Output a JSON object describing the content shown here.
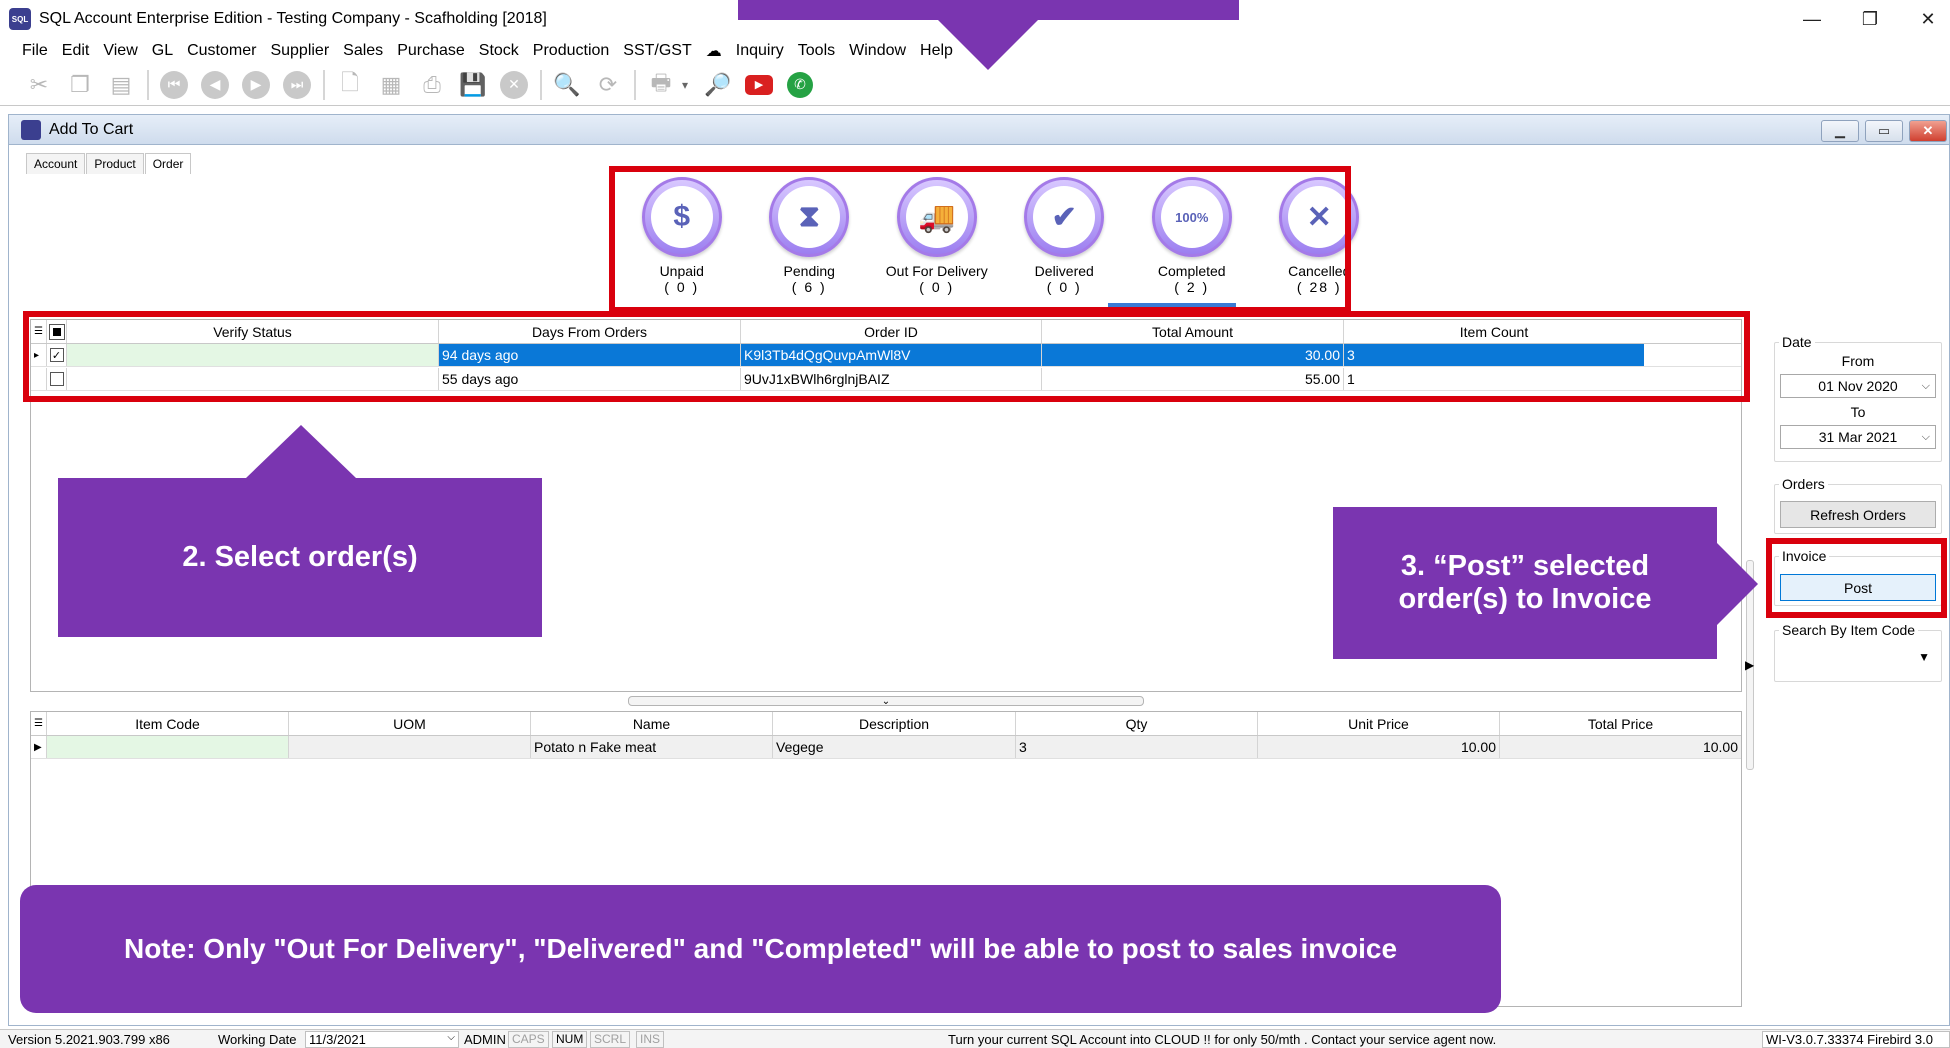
{
  "window": {
    "title": "SQL Account Enterprise Edition - Testing Company - Scafholding [2018]",
    "app_icon_text": "SQL",
    "minimize": "—",
    "restore": "❐",
    "close": "✕"
  },
  "menu": [
    "File",
    "Edit",
    "View",
    "GL",
    "Customer",
    "Supplier",
    "Sales",
    "Purchase",
    "Stock",
    "Production",
    "SST/GST",
    "☁",
    "Inquiry",
    "Tools",
    "Window",
    "Help"
  ],
  "toolbar": {
    "icons": [
      "cut-icon",
      "copy-icon",
      "paste-icon",
      "first-icon",
      "prev-icon",
      "next-icon",
      "last-icon",
      "new-icon",
      "edit-icon",
      "print-preview-icon",
      "save-icon",
      "cancel-icon",
      "search-icon",
      "refresh-icon",
      "printer-icon",
      "preview-icon",
      "youtube-icon",
      "whatsapp-icon"
    ],
    "youtube_color": "#d92020",
    "whatsapp_color": "#25a244"
  },
  "inner_window": {
    "title": "Add To Cart",
    "tabs": [
      "Account",
      "Product",
      "Order"
    ],
    "active_tab": "Order"
  },
  "statuses": [
    {
      "label": "Unpaid",
      "count": "( 0 )",
      "icon": "unpaid-icon",
      "glyph": "$"
    },
    {
      "label": "Pending",
      "count": "( 6 )",
      "icon": "pending-icon",
      "glyph": "⧗"
    },
    {
      "label": "Out For Delivery",
      "count": "( 0 )",
      "icon": "delivery-truck-icon",
      "glyph": "🚚"
    },
    {
      "label": "Delivered",
      "count": "( 0 )",
      "icon": "delivered-truck-icon",
      "glyph": "✔"
    },
    {
      "label": "Completed",
      "count": "( 2 )",
      "icon": "completed-icon",
      "glyph": "100%"
    },
    {
      "label": "Cancelled",
      "count": "( 28 )",
      "icon": "cancelled-icon",
      "glyph": "✕"
    }
  ],
  "active_status": "Completed",
  "orders": {
    "columns": [
      "Verify Status",
      "Days From Orders",
      "Order ID",
      "Total Amount",
      "Item Count"
    ],
    "rows": [
      {
        "checked": true,
        "selected": true,
        "verify": "",
        "days": "94 days ago",
        "order_id": "K9l3Tb4dQgQuvpAmWl8V",
        "total": "30.00",
        "count": "3"
      },
      {
        "checked": false,
        "selected": false,
        "verify": "",
        "days": "55 days ago",
        "order_id": "9UvJ1xBWlh6rglnjBAIZ",
        "total": "55.00",
        "count": "1"
      }
    ]
  },
  "items": {
    "columns": [
      "Item Code",
      "UOM",
      "Name",
      "Description",
      "Qty",
      "Unit Price",
      "Total Price"
    ],
    "rows": [
      {
        "code": "",
        "uom": "",
        "name": "Potato n Fake meat",
        "description": "Vegege",
        "qty": "3",
        "unit_price": "10.00",
        "total_price": "10.00"
      }
    ]
  },
  "right_panel": {
    "date_legend": "Date",
    "from_label": "From",
    "from_value": "01 Nov 2020",
    "to_label": "To",
    "to_value": "31 Mar 2021",
    "orders_legend": "Orders",
    "refresh_button": "Refresh Orders",
    "invoice_legend": "Invoice",
    "post_button": "Post",
    "search_legend": "Search By Item Code"
  },
  "annotations": {
    "select": "2. Select order(s)",
    "post": "3. “Post” selected order(s) to Invoice",
    "note": "Note: Only \"Out For Delivery\", \"Delivered\" and \"Completed\" will be able to post to sales invoice",
    "color": "#7a35b0",
    "highlight_color": "#d9000d"
  },
  "statusbar": {
    "version": "Version 5.2021.903.799 x86",
    "working_date_label": "Working Date",
    "working_date": "11/3/2021",
    "user": "ADMIN",
    "keys": [
      "CAPS",
      "NUM",
      "SCRL",
      "INS"
    ],
    "active_keys": [
      "NUM"
    ],
    "message": "Turn your current SQL Account into CLOUD !! for only 50/mth . Contact your service agent now.",
    "build": "WI-V3.0.7.33374 Firebird 3.0"
  }
}
